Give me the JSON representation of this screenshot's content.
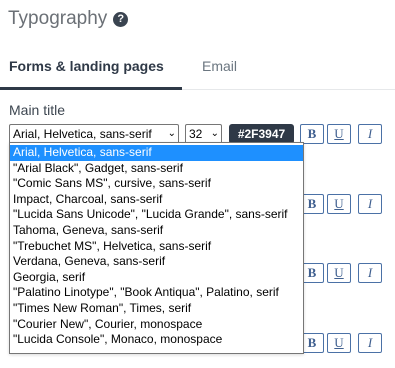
{
  "header": {
    "title": "Typography",
    "help_icon": "?"
  },
  "tabs": [
    {
      "label": "Forms & landing pages",
      "active": true
    },
    {
      "label": "Email",
      "active": false
    }
  ],
  "main_title": {
    "label": "Main title",
    "font_value": "Arial, Helvetica, sans-serif",
    "size_value": "32",
    "color_value": "#2F3947",
    "bold_label": "B",
    "underline_label": "U",
    "italic_label": "I"
  },
  "font_dropdown": {
    "options": [
      "Arial, Helvetica, sans-serif",
      "\"Arial Black\", Gadget, sans-serif",
      "\"Comic Sans MS\", cursive, sans-serif",
      "Impact, Charcoal, sans-serif",
      "\"Lucida Sans Unicode\", \"Lucida Grande\", sans-serif",
      "Tahoma, Geneva, sans-serif",
      "\"Trebuchet MS\", Helvetica, sans-serif",
      "Verdana, Geneva, sans-serif",
      "Georgia, serif",
      "\"Palatino Linotype\", \"Book Antiqua\", Palatino, serif",
      "\"Times New Roman\", Times, serif",
      "\"Courier New\", Courier, monospace",
      "\"Lucida Console\", Monaco, monospace"
    ],
    "selected_index": 0
  },
  "hidden_rows": {
    "underline_label": "U",
    "italic_label": "I"
  },
  "colors": {
    "text": "#2F3947",
    "accent_button_border": "#4B71A6",
    "dropdown_highlight": "#1E90FF"
  }
}
